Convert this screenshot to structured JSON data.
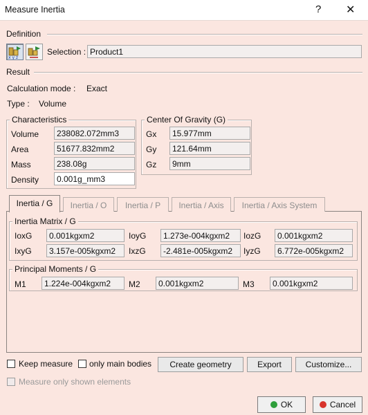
{
  "window": {
    "title": "Measure Inertia",
    "help_glyph": "?",
    "close_glyph": "✕"
  },
  "definition": {
    "label": "Definition",
    "selection_label": "Selection :",
    "selection_value": "Product1"
  },
  "result": {
    "label": "Result",
    "calc_mode_label": "Calculation mode :",
    "calc_mode_value": "Exact",
    "type_label": "Type :",
    "type_value": "Volume"
  },
  "characteristics": {
    "title": "Characteristics",
    "rows": [
      {
        "label": "Volume",
        "value": "238082.072mm3"
      },
      {
        "label": "Area",
        "value": "51677.832mm2"
      },
      {
        "label": "Mass",
        "value": "238.08g"
      },
      {
        "label": "Density",
        "value": "0.001g_mm3"
      }
    ]
  },
  "cog": {
    "title": "Center Of Gravity (G)",
    "rows": [
      {
        "label": "Gx",
        "value": "15.977mm"
      },
      {
        "label": "Gy",
        "value": "121.64mm"
      },
      {
        "label": "Gz",
        "value": "9mm"
      }
    ]
  },
  "tabs": [
    {
      "label": "Inertia / G",
      "active": true
    },
    {
      "label": "Inertia / O",
      "active": false
    },
    {
      "label": "Inertia / P",
      "active": false
    },
    {
      "label": "Inertia / Axis",
      "active": false
    },
    {
      "label": "Inertia / Axis System",
      "active": false
    }
  ],
  "inertia_matrix": {
    "title": "Inertia Matrix / G",
    "cells": [
      {
        "label": "IoxG",
        "value": "0.001kgxm2"
      },
      {
        "label": "IoyG",
        "value": "1.273e-004kgxm2"
      },
      {
        "label": "IozG",
        "value": "0.001kgxm2"
      },
      {
        "label": "IxyG",
        "value": "3.157e-005kgxm2"
      },
      {
        "label": "IxzG",
        "value": "-2.481e-005kgxm2"
      },
      {
        "label": "IyzG",
        "value": "6.772e-005kgxm2"
      }
    ]
  },
  "principal_moments": {
    "title": "Principal Moments / G",
    "cells": [
      {
        "label": "M1",
        "value": "1.224e-004kgxm2"
      },
      {
        "label": "M2",
        "value": "0.001kgxm2"
      },
      {
        "label": "M3",
        "value": "0.001kgxm2"
      }
    ]
  },
  "options": {
    "keep_measure": "Keep measure",
    "only_main_bodies": "only main bodies",
    "measure_only_shown": "Measure only shown elements",
    "create_geometry": "Create geometry",
    "export": "Export",
    "customize": "Customize..."
  },
  "footer": {
    "ok": "OK",
    "cancel": "Cancel"
  },
  "colors": {
    "background": "#fbe6e0",
    "ok_dot": "#2e9e3a",
    "cancel_dot": "#d8342c"
  }
}
